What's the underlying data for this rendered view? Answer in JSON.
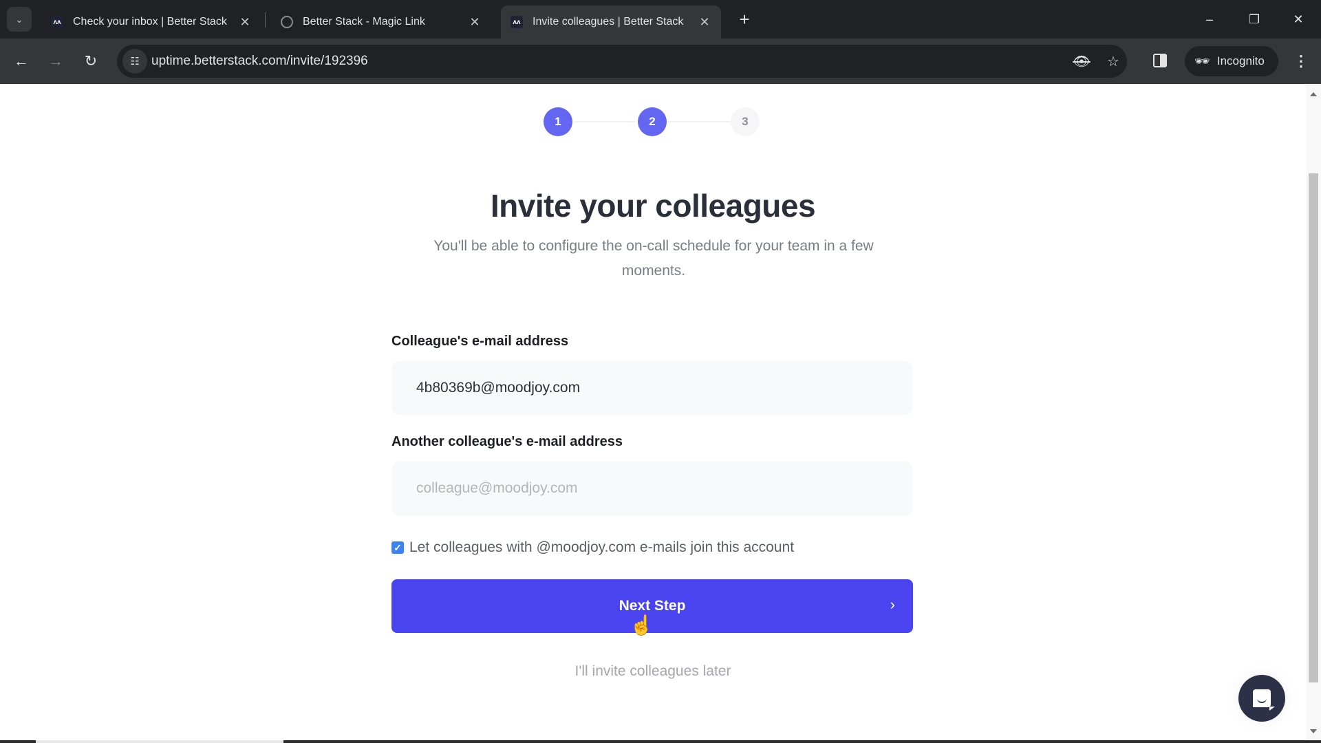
{
  "browser": {
    "tabs": [
      {
        "title": "Check your inbox | Better Stack",
        "favicon": "betterstack-logo-icon",
        "active": false
      },
      {
        "title": "Better Stack - Magic Link",
        "favicon": "globe-icon",
        "active": false
      },
      {
        "title": "Invite colleagues | Better Stack",
        "favicon": "betterstack-logo-icon",
        "active": true
      }
    ],
    "tab_close_glyph": "✕",
    "tab_search_glyph": "⌄",
    "new_tab_glyph": "+",
    "window_controls": {
      "minimize": "–",
      "restore": "❐",
      "close": "✕"
    },
    "nav": {
      "back": "←",
      "forward": "→",
      "reload": "↻"
    },
    "site_info_glyph": "☷",
    "url": "uptime.betterstack.com/invite/192396",
    "omnibox_icons": {
      "tracking_blocked": "👁",
      "bookmark": "☆"
    },
    "incognito_label": "Incognito",
    "incognito_glyph": "🕶",
    "menu_glyph": "⋮"
  },
  "steps": {
    "items": [
      {
        "label": "1",
        "state": "done"
      },
      {
        "label": "2",
        "state": "done"
      },
      {
        "label": "3",
        "state": "todo"
      }
    ],
    "current": 2,
    "total": 3
  },
  "main": {
    "title": "Invite your colleagues",
    "subtitle": "You'll be able to configure the on-call schedule for your team in a few moments.",
    "fields": [
      {
        "label": "Colleague's e-mail address",
        "value": "4b80369b@moodjoy.com",
        "placeholder": "colleague@moodjoy.com"
      },
      {
        "label": "Another colleague's e-mail address",
        "value": "",
        "placeholder": "colleague@moodjoy.com"
      }
    ],
    "allow_domain_join": {
      "checked": true,
      "label": "Let colleagues with @moodjoy.com e-mails join this account"
    },
    "next_button": {
      "label": "Next Step",
      "chevron": "›"
    },
    "skip_link": "I'll invite colleagues later"
  },
  "colors": {
    "accent": "#4a44f0",
    "step_active": "#6366f1",
    "chat_button": "#2c3147"
  }
}
